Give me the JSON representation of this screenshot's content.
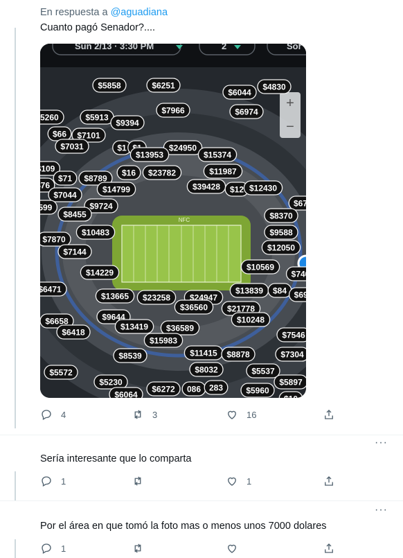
{
  "tweet1": {
    "reply_prefix": "En respuesta a",
    "reply_handle": "@aguadiana",
    "text": "Cuanto pagó Senador?....",
    "media": {
      "header_date": "Sun 2/13 · 3:30 PM",
      "header_qty": "2",
      "header_sort": "Sor",
      "field_label": "NFC",
      "price_tags": [
        "$5858",
        "$6251",
        "$6044",
        "$4830",
        "$7966",
        "$6974",
        "$5913",
        "$9394",
        "$5260",
        "$66",
        "$7101",
        "$7031",
        "$1",
        "$1",
        "$24950",
        "$13953",
        "$15374",
        "$109",
        "$71",
        "$8789",
        "$16",
        "$23782",
        "$11987",
        "$76",
        "$14799",
        "$7044",
        "$39428",
        "$12",
        "$12430",
        "$599",
        "$9724",
        "$67",
        "$8455",
        "$8370",
        "$10483",
        "$9588",
        "$7870",
        "$7144",
        "$12050",
        "$10569",
        "$14229",
        "$740",
        "$6471",
        "$13665",
        "$23258",
        "$24947",
        "$13839",
        "$84",
        "$690",
        "$36560",
        "$21778",
        "$6658",
        "$9644",
        "$13419",
        "$36589",
        "$10248",
        "$6418",
        "$15983",
        "$7546",
        "$8539",
        "$11415",
        "$8878",
        "$7304",
        "$8032",
        "$5537",
        "$5572",
        "$5230",
        "$5897",
        "$6064",
        "$6272",
        "086",
        "283",
        "$5960",
        "$10"
      ],
      "zoom_in": "+",
      "zoom_out": "−"
    },
    "reply_count": "4",
    "retweet_count": "3",
    "like_count": "16"
  },
  "tweet2": {
    "more": "···",
    "text": "Sería interesante que lo comparta",
    "reply_count": "1",
    "retweet_count": "",
    "like_count": "1"
  },
  "tweet3": {
    "more": "···",
    "text": "Por el área en que tomó la foto mas o menos unos 7000 dolares",
    "reply_count": "1",
    "retweet_count": "",
    "like_count": ""
  },
  "icons": {
    "reply": "reply-icon",
    "retweet": "retweet-icon",
    "like": "heart-icon",
    "share": "share-icon"
  },
  "colors": {
    "link": "#1d9bf0",
    "muted": "#536471",
    "field": "#8dba3b",
    "tag_bg": "#121212"
  }
}
